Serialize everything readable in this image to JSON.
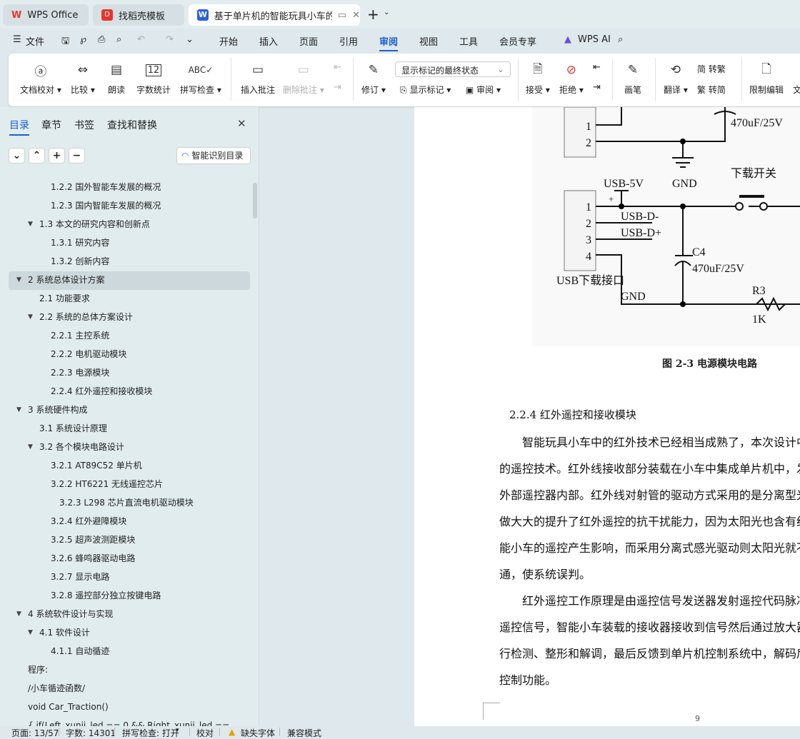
{
  "tabs": [
    {
      "label": "WPS Office",
      "icon": "wps-logo-icon"
    },
    {
      "label": "找稻壳模板",
      "icon": "docer-icon"
    },
    {
      "label": "基于单片机的智能玩具小车的设",
      "icon": "word-doc-icon",
      "active": true
    }
  ],
  "menu": {
    "file": "文件",
    "items": [
      "开始",
      "插入",
      "页面",
      "引用",
      "审阅",
      "视图",
      "工具",
      "会员专享"
    ],
    "active": "审阅",
    "ai": "WPS AI"
  },
  "ribbon": {
    "buttons": [
      "文档校对",
      "比较",
      "朗读",
      "字数统计",
      "拼写检查",
      "插入批注",
      "删除批注",
      "修订",
      "显示标记",
      "审阅",
      "接受",
      "拒绝",
      "画笔",
      "翻译",
      "转繁",
      "转简",
      "限制编辑",
      "文"
    ],
    "markup_select": "显示标记的最终状态",
    "word_count_icon": "12"
  },
  "panel": {
    "tabs": [
      "目录",
      "章节",
      "书签",
      "查找和替换"
    ],
    "active_tab": "目录",
    "smart_toc": "智能识别目录",
    "toc": [
      {
        "text": "1.2.2  国外智能车发展的概况",
        "level": 3
      },
      {
        "text": "1.2.3  国内智能车发展的概况",
        "level": 3
      },
      {
        "text": "1.3  本文的研究内容和创新点",
        "level": 2,
        "expanded": true
      },
      {
        "text": "1.3.1  研究内容",
        "level": 3
      },
      {
        "text": "1.3.2  创新内容",
        "level": 3
      },
      {
        "text": "2  系统总体设计方案",
        "level": 1,
        "expanded": true,
        "selected": true
      },
      {
        "text": "2.1 功能要求",
        "level": 2
      },
      {
        "text": "2.2 系统的总体方案设计",
        "level": 2,
        "expanded": true
      },
      {
        "text": "2.2.1 主控系统",
        "level": 3
      },
      {
        "text": "2.2.2 电机驱动模块",
        "level": 3
      },
      {
        "text": "2.2.3 电源模块",
        "level": 3
      },
      {
        "text": "2.2.4  红外遥控和接收模块",
        "level": 3
      },
      {
        "text": "3  系统硬件构成",
        "level": 1,
        "expanded": true
      },
      {
        "text": "3.1  系统设计原理",
        "level": 2
      },
      {
        "text": "3.2  各个模块电路设计",
        "level": 2,
        "expanded": true
      },
      {
        "text": "3.2.1 AT89C52 单片机",
        "level": 3
      },
      {
        "text": "3.2.2 HT6221 无线遥控芯片",
        "level": 3
      },
      {
        "text": "3.2.3 L298 芯片直流电机驱动模块",
        "level": 4
      },
      {
        "text": "3.2.4  红外避障模块",
        "level": 3
      },
      {
        "text": "3.2.5  超声波测距模块",
        "level": 3
      },
      {
        "text": "3.2.6  蜂鸣器驱动电路",
        "level": 3
      },
      {
        "text": "3.2.7  显示电路",
        "level": 3
      },
      {
        "text": "3.2.8  遥控部分独立按键电路",
        "level": 3
      },
      {
        "text": "4  系统软件设计与实现",
        "level": 1,
        "expanded": true
      },
      {
        "text": "4.1 软件设计",
        "level": 2,
        "expanded": true
      },
      {
        "text": "4.1.1 自动循迹",
        "level": 3
      },
      {
        "text": "程序:",
        "level": 1
      },
      {
        "text": "/小车循迹函数/",
        "level": 1
      },
      {
        "text": "void Car_Traction()",
        "level": 1
      },
      {
        "text": "{    if(Left_xunji_led  == 0 && Right_xunji_led ==",
        "level": 1
      }
    ]
  },
  "document": {
    "circuit": {
      "labels": [
        "1",
        "2",
        "470uF/25V",
        "GND",
        "下载开关",
        "USB-5V",
        "+",
        "1",
        "2",
        "3",
        "4",
        "USB-D-",
        "USB-D+",
        "C4",
        "470uF/25V",
        "USB下载接口",
        "GND",
        "R3",
        "1K"
      ]
    },
    "figure_caption": "图 2-3  电源模块电路",
    "heading": "2.2.4 红外遥控和接收模块",
    "lines": [
      "智能玩具小车中的红外技术已经相当成熟了，本次设计中",
      "的遥控技术。红外线接收部分装载在小车中集成单片机中，发",
      "外部遥控器内部。红外线对射管的驱动方式采用的是分离型光",
      "做大大的提升了红外遥控的抗干扰能力，因为太阳光也含有红",
      "能小车的遥控产生影响，而采用分离式感光驱动则太阳光就不",
      "通，使系统误判。",
      "红外遥控工作原理是由遥控信号发送器发射遥控代码脉冲",
      "遥控信号，智能小车装载的接收器接收到信号然后通过放大器",
      "行检测、整形和解调，最后反馈到单片机控制系统中，解码后",
      "控制功能。"
    ],
    "page_number": "9"
  },
  "status": {
    "page": "页面: 13/57",
    "words": "字数: 14301",
    "spell": "拼写检查: 打开",
    "proof": "校对",
    "missing_font": "缺失字体",
    "compat": "兼容模式"
  },
  "colors": {
    "accent": "#1a5fd0",
    "wps_red": "#e8352b",
    "word_blue": "#2b5fde"
  }
}
